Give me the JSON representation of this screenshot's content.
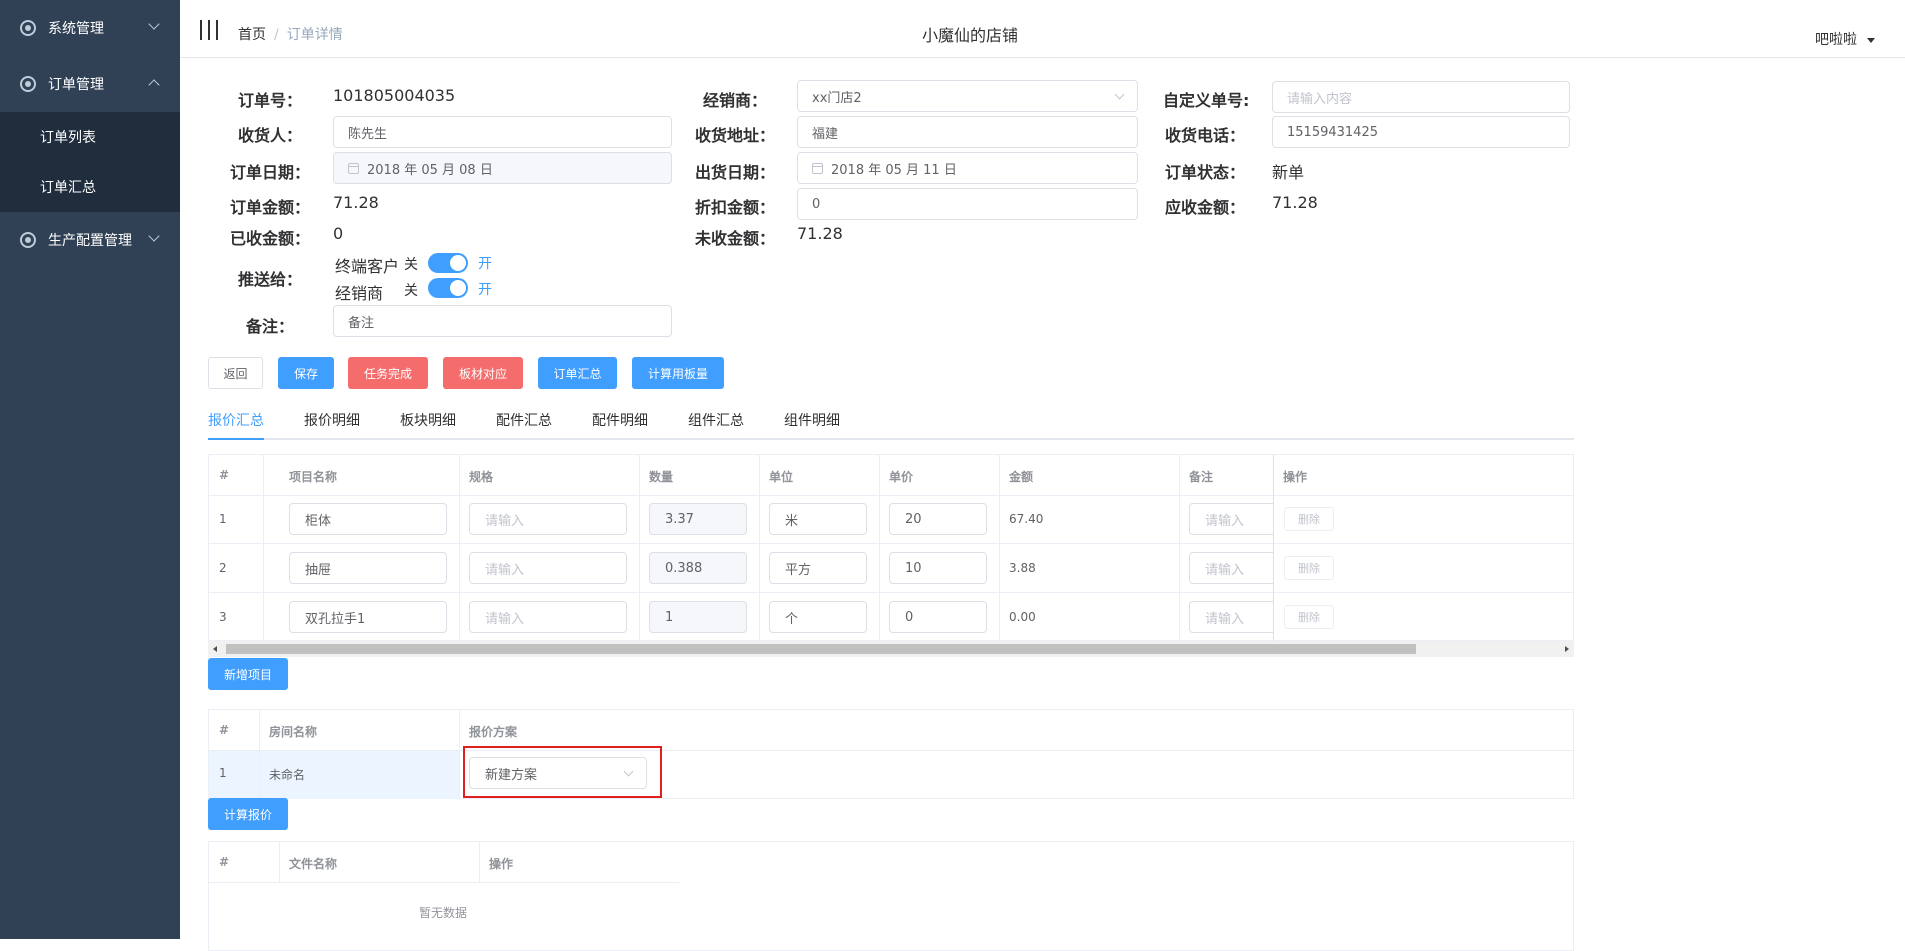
{
  "sidebar": {
    "items": [
      {
        "label": "系统管理"
      },
      {
        "label": "订单管理"
      },
      {
        "label": "订单列表"
      },
      {
        "label": "订单汇总"
      },
      {
        "label": "生产配置管理"
      }
    ]
  },
  "navbar": {
    "breadcrumb_home": "首页",
    "breadcrumb_sep": "/",
    "breadcrumb_current": "订单详情",
    "shop_name": "小魔仙的店铺",
    "user_name": "吧啦啦"
  },
  "form": {
    "order_no_label": "订单号：",
    "order_no": "101805004035",
    "dealer_label": "经销商：",
    "dealer": "xx门店2",
    "custom_no_label": "自定义单号:",
    "custom_no_placeholder": "请输入内容",
    "receiver_label": "收货人：",
    "receiver": "陈先生",
    "address_label": "收货地址：",
    "address": "福建",
    "phone_label": "收货电话：",
    "phone": "15159431425",
    "order_date_label": "订单日期：",
    "order_date": "2018 年 05 月 08 日",
    "ship_date_label": "出货日期：",
    "ship_date": "2018 年 05 月 11 日",
    "status_label": "订单状态：",
    "status": "新单",
    "amount_label": "订单金额：",
    "amount": "71.28",
    "discount_label": "折扣金额：",
    "discount": "0",
    "receivable_label": "应收金额：",
    "receivable": "71.28",
    "received_label": "已收金额：",
    "received": "0",
    "unreceived_label": "未收金额：",
    "unreceived": "71.28",
    "push_label": "推送给：",
    "push_customer": "终端客户",
    "push_dealer": "经销商",
    "switch_off": "关",
    "switch_on": "开",
    "remark_label": "备注：",
    "remark_placeholder": "备注"
  },
  "buttons": {
    "back": "返回",
    "save": "保存",
    "complete": "任务完成",
    "board": "板材对应",
    "summary": "订单汇总",
    "calc_board": "计算用板量",
    "add_item": "新增项目",
    "calc_quote": "计算报价"
  },
  "tabs": [
    "报价汇总",
    "报价明细",
    "板块明细",
    "配件汇总",
    "配件明细",
    "组件汇总",
    "组件明细"
  ],
  "items_table": {
    "headers": [
      "#",
      "项目名称",
      "规格",
      "数量",
      "单位",
      "单价",
      "金额",
      "备注",
      "操作"
    ],
    "spec_placeholder": "请输入",
    "remark_placeholder": "请输入",
    "delete_label": "删除",
    "rows": [
      {
        "no": "1",
        "name": "柜体",
        "qty": "3.37",
        "unit": "米",
        "price": "20",
        "amount": "67.40"
      },
      {
        "no": "2",
        "name": "抽屉",
        "qty": "0.388",
        "unit": "平方",
        "price": "10",
        "amount": "3.88"
      },
      {
        "no": "3",
        "name": "双孔拉手1",
        "qty": "1",
        "unit": "个",
        "price": "0",
        "amount": "0.00"
      }
    ]
  },
  "room_table": {
    "headers": [
      "#",
      "房间名称",
      "报价方案"
    ],
    "rows": [
      {
        "no": "1",
        "name": "未命名",
        "plan": "新建方案"
      }
    ]
  },
  "file_table": {
    "headers": [
      "#",
      "文件名称",
      "操作"
    ],
    "empty": "暂无数据"
  }
}
